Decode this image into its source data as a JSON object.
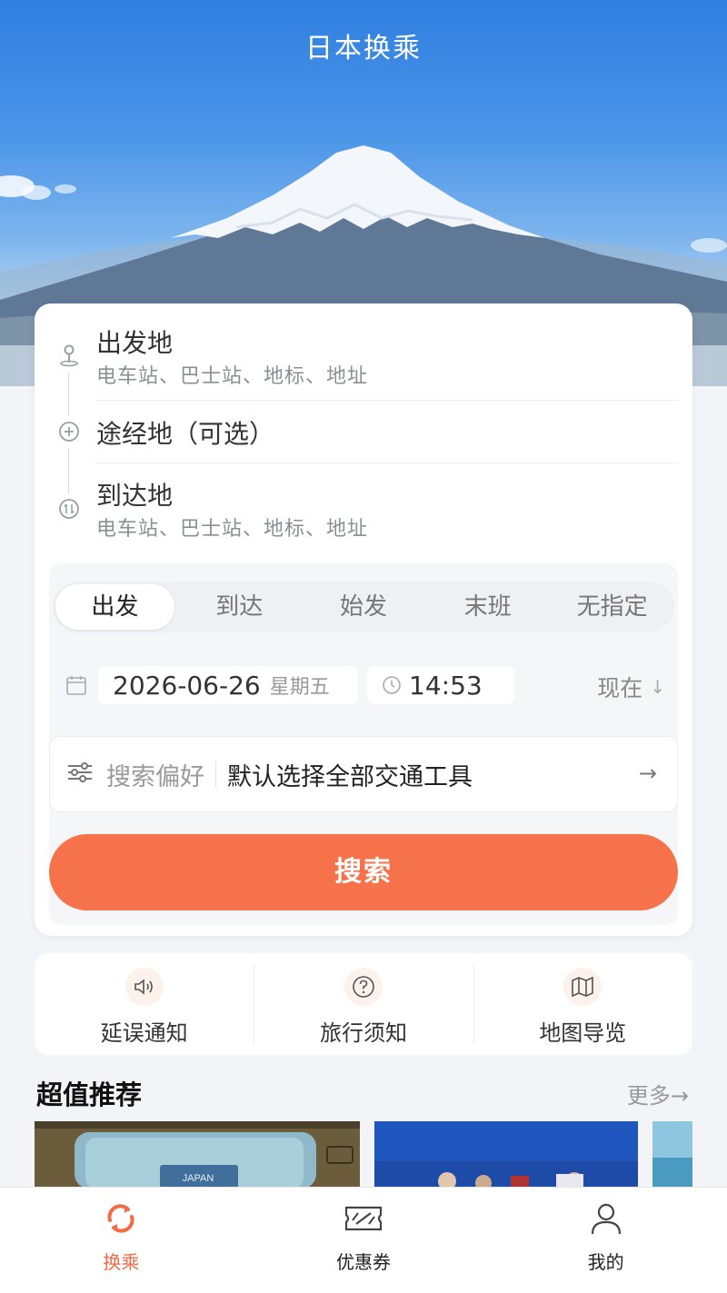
{
  "app": {
    "title": "日本换乘"
  },
  "route": {
    "origin": {
      "label": "出发地",
      "placeholder": "电车站、巴士站、地标、地址"
    },
    "via": {
      "label": "途经地（可选）"
    },
    "destination": {
      "label": "到达地",
      "placeholder": "电车站、巴士站、地标、地址"
    }
  },
  "modes": [
    "出发",
    "到达",
    "始发",
    "末班",
    "无指定"
  ],
  "selected_mode": "出发",
  "datetime": {
    "date": "2026-06-26",
    "weekday": "星期五",
    "time": "14:53",
    "now_label": "现在"
  },
  "preference": {
    "label": "搜索偏好",
    "value": "默认选择全部交通工具"
  },
  "search_button": "搜索",
  "quick_links": [
    {
      "label": "延误通知",
      "icon": "speaker-icon"
    },
    {
      "label": "旅行须知",
      "icon": "question-icon"
    },
    {
      "label": "地图导览",
      "icon": "map-icon"
    }
  ],
  "recommend": {
    "title": "超值推荐",
    "more": "更多→",
    "thumb_text": "JAPAN"
  },
  "tabs": [
    {
      "label": "换乘",
      "icon": "transfer-icon",
      "active": true
    },
    {
      "label": "优惠券",
      "icon": "coupon-icon",
      "active": false
    },
    {
      "label": "我的",
      "icon": "user-icon",
      "active": false
    }
  ],
  "colors": {
    "accent": "#f6724a",
    "tab_active": "#f26b45",
    "sky": "#2f7fe0",
    "page_bg": "#f3f4f8"
  }
}
